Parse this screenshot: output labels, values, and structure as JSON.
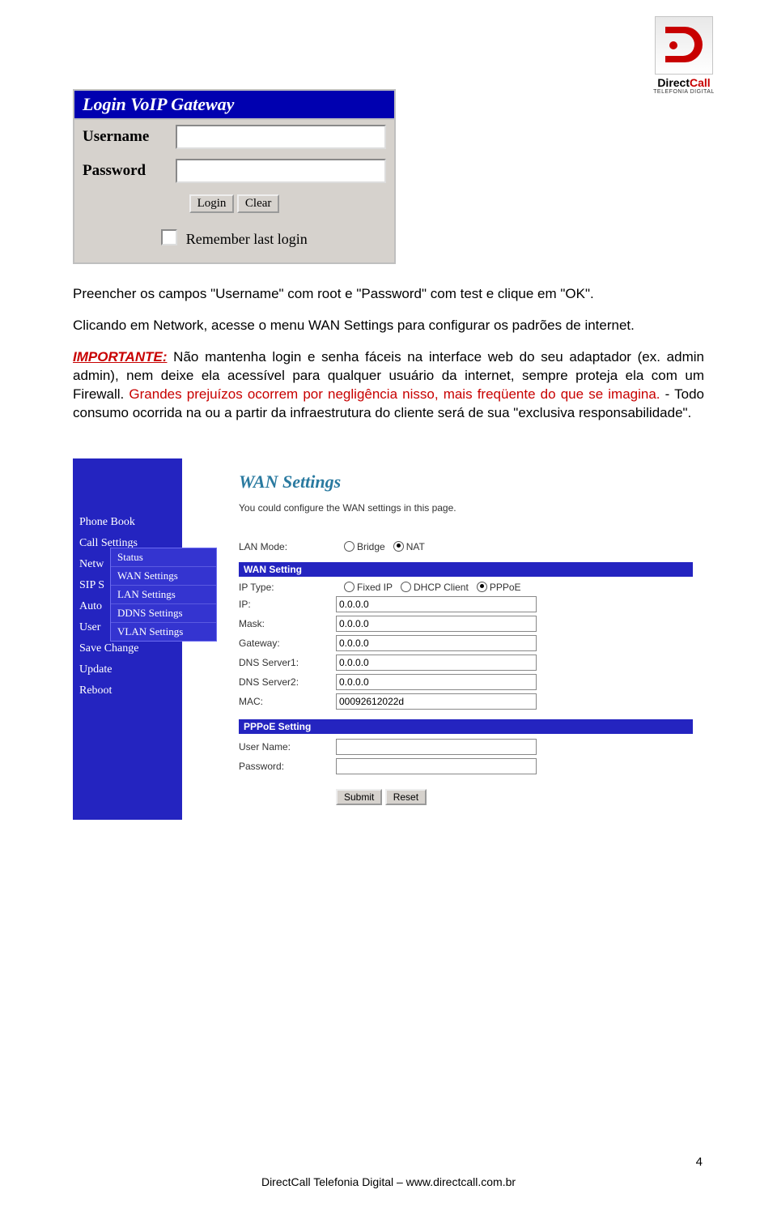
{
  "logo": {
    "brand_a": "Direct",
    "brand_b": "Call",
    "sub": "TELEFONIA DIGITAL"
  },
  "login": {
    "title": "Login VoIP Gateway",
    "username_label": "Username",
    "password_label": "Password",
    "login_btn": "Login",
    "clear_btn": "Clear",
    "remember": "Remember last login"
  },
  "copy": {
    "p1": "Preencher os campos \"Username\" com root e \"Password\" com test e clique em \"OK\".",
    "p2": "Clicando em Network, acesse o menu WAN Settings para configurar os padrões de internet.",
    "important_label": "IMPORTANTE:",
    "p3a": " Não mantenha login e senha fáceis na interface web do seu adaptador (ex. admin admin), nem deixe ela acessível para qualquer usuário da internet, sempre proteja ela com um Firewall. ",
    "p3b": "Grandes prejuízos ocorrem por negligência nisso, mais freqüente do que se imagina.",
    "p3c": " - Todo consumo ocorrida na ou a partir da infraestrutura do cliente será de sua \"exclusiva responsabilidade\"."
  },
  "sidebar": {
    "items": [
      "Phone Book",
      "Call Settings",
      "Netw",
      "SIP S",
      "Auto",
      "User",
      "Save Change",
      "Update",
      "Reboot"
    ],
    "submenu": [
      "Status",
      "WAN Settings",
      "LAN Settings",
      "DDNS Settings",
      "VLAN Settings"
    ]
  },
  "wan": {
    "heading": "WAN Settings",
    "desc": "You could configure the WAN settings in this page.",
    "lan_mode_label": "LAN Mode:",
    "lan_modes": {
      "bridge": "Bridge",
      "nat": "NAT",
      "selected": "nat"
    },
    "section1": "WAN Setting",
    "ip_type_label": "IP Type:",
    "ip_types": {
      "fixed": "Fixed IP",
      "dhcp": "DHCP Client",
      "pppoe": "PPPoE",
      "selected": "pppoe"
    },
    "fields": {
      "ip": {
        "label": "IP:",
        "value": "0.0.0.0"
      },
      "mask": {
        "label": "Mask:",
        "value": "0.0.0.0"
      },
      "gateway": {
        "label": "Gateway:",
        "value": "0.0.0.0"
      },
      "dns1": {
        "label": "DNS Server1:",
        "value": "0.0.0.0"
      },
      "dns2": {
        "label": "DNS Server2:",
        "value": "0.0.0.0"
      },
      "mac": {
        "label": "MAC:",
        "value": "00092612022d"
      }
    },
    "section2": "PPPoE Setting",
    "ppp": {
      "user_label": "User Name:",
      "pass_label": "Password:"
    },
    "submit": "Submit",
    "reset": "Reset"
  },
  "footer": "DirectCall Telefonia Digital – www.directcall.com.br",
  "page_number": "4"
}
